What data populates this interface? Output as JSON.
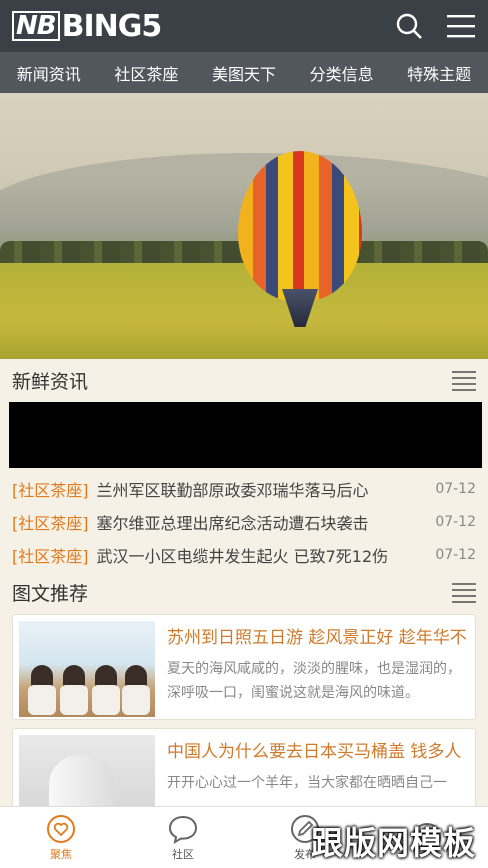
{
  "header": {
    "logo_prefix": "NB",
    "logo_text": "BING5"
  },
  "nav": {
    "items": [
      "新闻资讯",
      "社区茶座",
      "美图天下",
      "分类信息",
      "特殊主题"
    ]
  },
  "section_news": {
    "title": "新鲜资讯",
    "items": [
      {
        "tag": "[社区茶座]",
        "title": "兰州军区联勤部原政委邓瑞华落马后心",
        "date": "07-12"
      },
      {
        "tag": "[社区茶座]",
        "title": "塞尔维亚总理出席纪念活动遭石块袭击",
        "date": "07-12"
      },
      {
        "tag": "[社区茶座]",
        "title": "武汉一小区电缆井发生起火 已致7死12伤",
        "date": "07-12"
      }
    ]
  },
  "section_pics": {
    "title": "图文推荐",
    "cards": [
      {
        "title": "苏州到日照五日游 趁风景正好 趁年华不",
        "desc": "夏天的海风咸咸的，淡淡的腥味，也是湿润的，深呼吸一口，闺蜜说这就是海风的味道。"
      },
      {
        "title": "中国人为什么要去日本买马桶盖 钱多人",
        "desc": "开开心心过一个羊年，当大家都在晒晒自己一"
      }
    ]
  },
  "tabbar": {
    "tabs": [
      "聚焦",
      "社区",
      "发布",
      ""
    ]
  },
  "watermark": "跟版网模板",
  "colors": {
    "accent": "#e27a1c",
    "header_bg": "#3b4047",
    "nav_bg": "#52575e"
  }
}
